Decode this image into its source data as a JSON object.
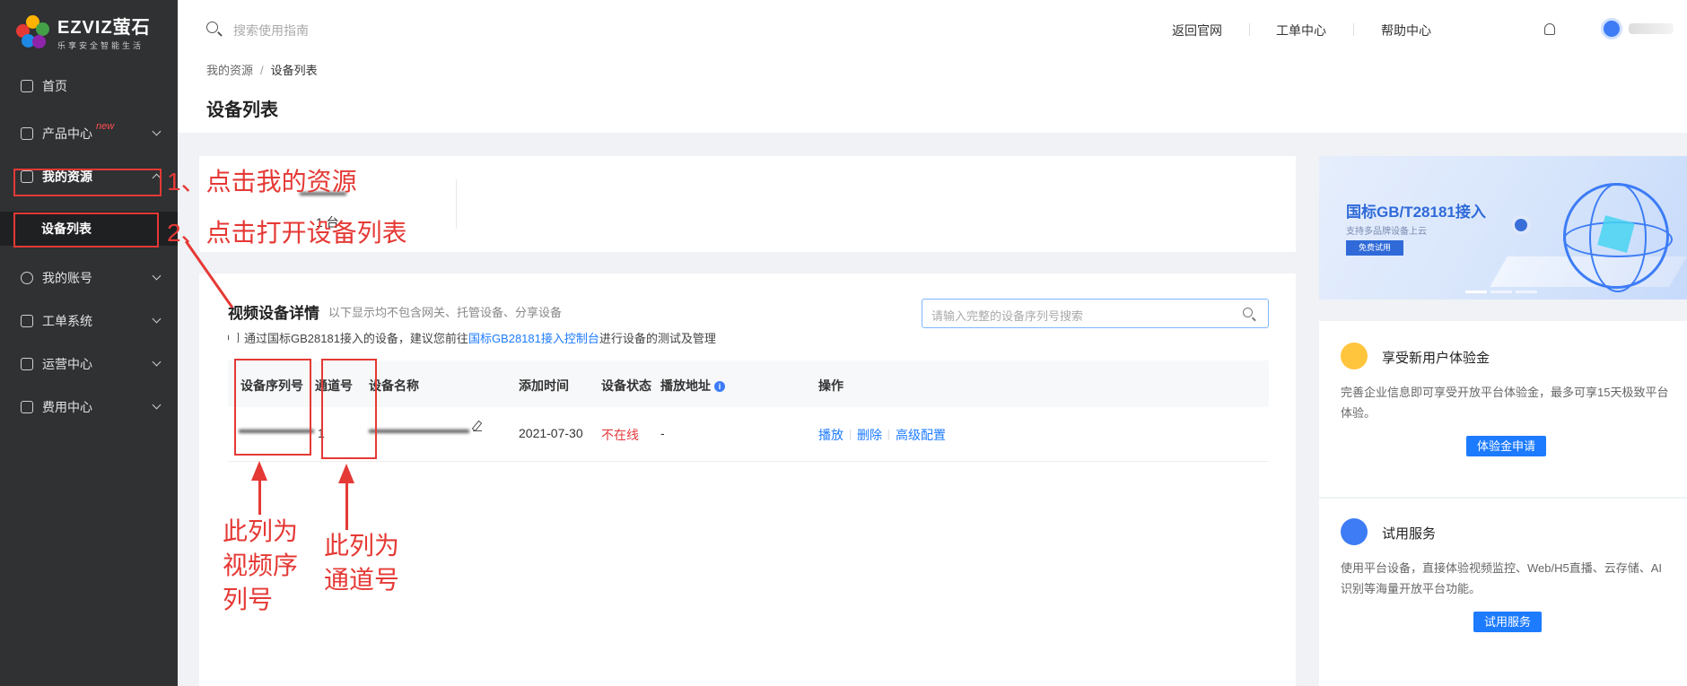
{
  "brand": {
    "name": "EZVIZ萤石",
    "slogan": "乐享安全智能生活"
  },
  "sidebar": {
    "items": [
      {
        "label": "首页",
        "icon": "home-icon"
      },
      {
        "label": "产品中心",
        "icon": "box-icon",
        "badge": "new"
      },
      {
        "label": "我的资源",
        "icon": "resource-icon"
      },
      {
        "label": "我的账号",
        "icon": "account-icon"
      },
      {
        "label": "工单系统",
        "icon": "ticket-icon"
      },
      {
        "label": "运营中心",
        "icon": "operation-icon"
      },
      {
        "label": "费用中心",
        "icon": "billing-icon"
      }
    ],
    "sub_item": "设备列表"
  },
  "topbar": {
    "search_placeholder": "搜索使用指南",
    "links": [
      "返回官网",
      "工单中心",
      "帮助中心"
    ]
  },
  "breadcrumb": {
    "root": "我的资源",
    "sep": "/",
    "current": "设备列表"
  },
  "page_title": "设备列表",
  "stats": {
    "value": "1 台"
  },
  "section": {
    "title": "视频设备详情",
    "subtitle": "以下显示均不包含网关、托管设备、分享设备",
    "notice_prefix": "通过国标GB28181接入的设备，建议您前往",
    "notice_link": "国标GB28181接入控制台",
    "notice_suffix": "进行设备的测试及管理",
    "search_placeholder": "请输入完整的设备序列号搜索"
  },
  "table": {
    "columns": [
      "设备序列号",
      "通道号",
      "设备名称",
      "添加时间",
      "设备状态",
      "播放地址",
      "操作"
    ],
    "rows": [
      {
        "channel": "1",
        "add_time": "2021-07-30",
        "status": "不在线",
        "play_url": "-",
        "actions": [
          "播放",
          "删除",
          "高级配置"
        ]
      }
    ]
  },
  "banner": {
    "title": "国标GB/T28181接入",
    "subtitle": "支持多品牌设备上云",
    "button": "免费试用"
  },
  "cards": [
    {
      "title": "享受新用户体验金",
      "text": "完善企业信息即可享受开放平台体验金，最多可享15天极致平台体验。",
      "button": "体验金申请",
      "icon_color": "#ffc53d"
    },
    {
      "title": "试用服务",
      "text": "使用平台设备，直接体验视频监控、Web/H5直播、云存储、AI识别等海量开放平台功能。",
      "button": "试用服务",
      "icon_color": "#3d7cf5"
    }
  ],
  "annotations": {
    "step1": "1、点击我的资源",
    "step2": "2、点击打开设备列表",
    "serial_note": "此列为视频序列号",
    "channel_note": "此列为通道号"
  },
  "colors": {
    "accent": "#1d7bff",
    "annotation": "#e53935",
    "sidebar": "#2f3133",
    "offline": "#e4393c"
  }
}
